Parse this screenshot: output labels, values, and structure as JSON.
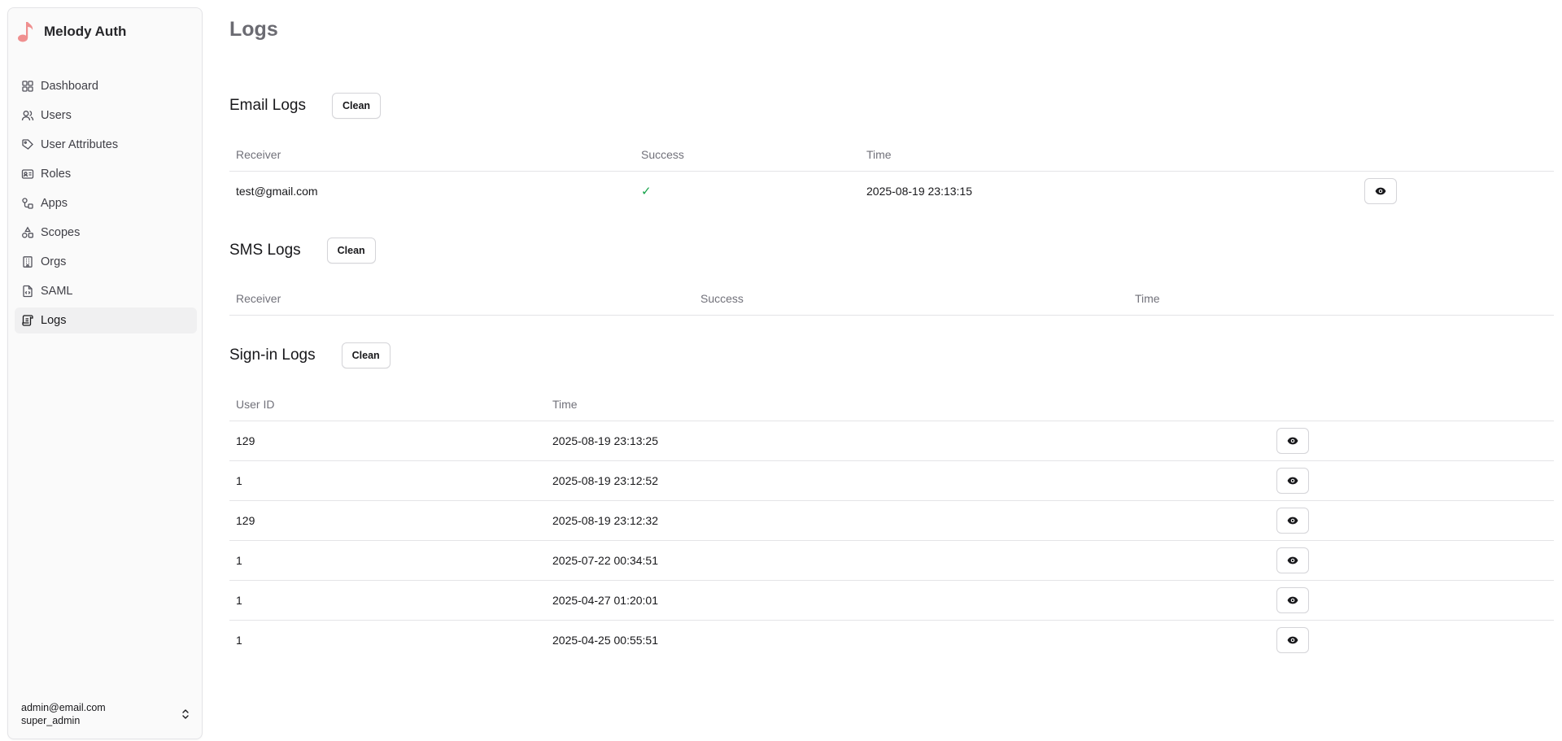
{
  "app": {
    "name": "Melody Auth"
  },
  "sidebar": {
    "items": [
      {
        "label": "Dashboard",
        "icon": "dashboard-icon"
      },
      {
        "label": "Users",
        "icon": "users-icon"
      },
      {
        "label": "User Attributes",
        "icon": "tag-icon"
      },
      {
        "label": "Roles",
        "icon": "id-card-icon"
      },
      {
        "label": "Apps",
        "icon": "apps-icon"
      },
      {
        "label": "Scopes",
        "icon": "shapes-icon"
      },
      {
        "label": "Orgs",
        "icon": "building-icon"
      },
      {
        "label": "SAML",
        "icon": "file-code-icon"
      },
      {
        "label": "Logs",
        "icon": "scroll-icon"
      }
    ],
    "active": "Logs"
  },
  "user": {
    "email": "admin@email.com",
    "role": "super_admin"
  },
  "page": {
    "title": "Logs"
  },
  "email_logs": {
    "title": "Email Logs",
    "clean_label": "Clean",
    "columns": [
      "Receiver",
      "Success",
      "Time"
    ],
    "rows": [
      {
        "receiver": "test@gmail.com",
        "success": "✓",
        "time": "2025-08-19 23:13:15"
      }
    ]
  },
  "sms_logs": {
    "title": "SMS Logs",
    "clean_label": "Clean",
    "columns": [
      "Receiver",
      "Success",
      "Time"
    ],
    "rows": []
  },
  "signin_logs": {
    "title": "Sign-in Logs",
    "clean_label": "Clean",
    "columns": [
      "User ID",
      "Time"
    ],
    "rows": [
      {
        "user_id": "129",
        "time": "2025-08-19 23:13:25"
      },
      {
        "user_id": "1",
        "time": "2025-08-19 23:12:52"
      },
      {
        "user_id": "129",
        "time": "2025-08-19 23:12:32"
      },
      {
        "user_id": "1",
        "time": "2025-07-22 00:34:51"
      },
      {
        "user_id": "1",
        "time": "2025-04-27 01:20:01"
      },
      {
        "user_id": "1",
        "time": "2025-04-25 00:55:51"
      }
    ]
  },
  "colors": {
    "brand": "#ef8f8f",
    "success": "#16a34a",
    "active_bg": "#f0f0f1"
  }
}
